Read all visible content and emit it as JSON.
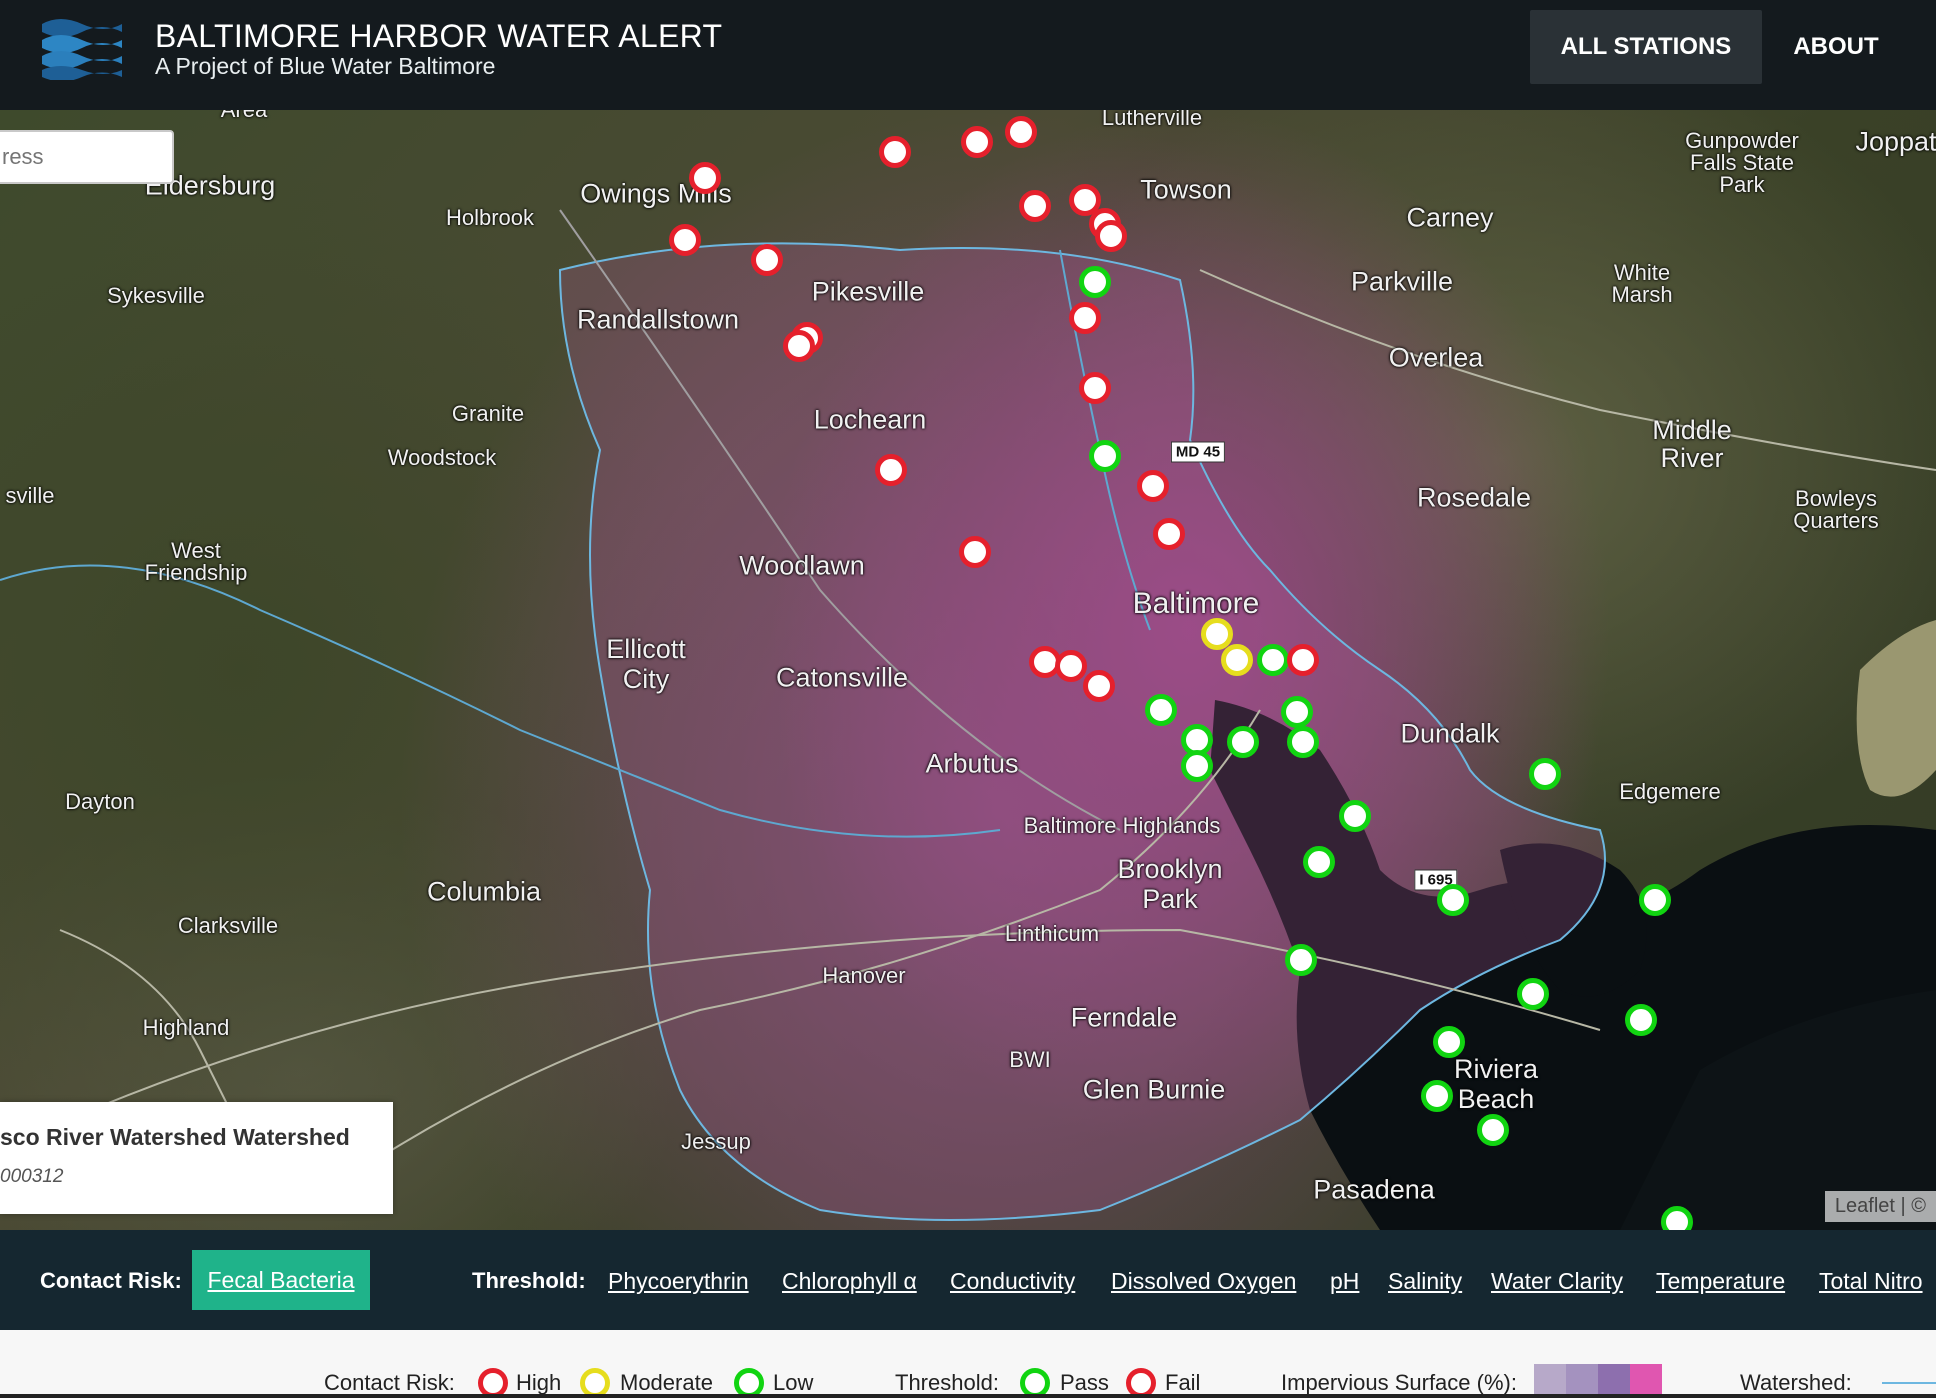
{
  "header": {
    "title": "BALTIMORE HARBOR WATER ALERT",
    "subtitle": "A Project of Blue Water Baltimore",
    "nav": {
      "all_stations": "ALL STATIONS",
      "about": "ABOUT"
    }
  },
  "search": {
    "placeholder": "ress"
  },
  "map": {
    "places": [
      "Area",
      "Eldersburg",
      "Owings Mills",
      "Holbrook",
      "Lutherville",
      "Towson",
      "Gunpowder Falls State Park",
      "Joppat",
      "Carney",
      "Sykesville",
      "Pikesville",
      "Randallstown",
      "White Marsh",
      "Parkville",
      "Overlea",
      "Granite",
      "Woodstock",
      "Lochearn",
      "Middle River",
      "sville",
      "Rosedale",
      "Bowleys Quarters",
      "West Friendship",
      "Woodlawn",
      "Baltimore",
      "Ellicott City",
      "Catonsville",
      "Dundalk",
      "Arbutus",
      "Edgemere",
      "Dayton",
      "Baltimore Highlands",
      "Brooklyn Park",
      "Columbia",
      "Linthicum",
      "Clarksville",
      "Hanover",
      "Highland",
      "Ferndale",
      "BWI",
      "Glen Burnie",
      "Riviera Beach",
      "Jessup",
      "Pasadena"
    ],
    "road_shields": [
      "MD 45",
      "I 695"
    ],
    "attribution": "Leaflet | ©"
  },
  "info_panel": {
    "title": "sco River Watershed Watershed",
    "id": "000312"
  },
  "filter_bar": {
    "contact_label": "Contact Risk:",
    "contact_active": "Fecal Bacteria",
    "threshold_label": "Threshold:",
    "threshold_items": [
      "Phycoerythrin",
      "Chlorophyll α",
      "Conductivity",
      "Dissolved Oxygen",
      "pH",
      "Salinity",
      "Water Clarity",
      "Temperature",
      "Total Nitro"
    ]
  },
  "legend": {
    "contact_label": "Contact Risk:",
    "high": "High",
    "moderate": "Moderate",
    "low": "Low",
    "threshold_label": "Threshold:",
    "pass": "Pass",
    "fail": "Fail",
    "impervious_label": "Impervious Surface (%):",
    "watershed_label": "Watershed:",
    "colors": {
      "high": "#e5202c",
      "moderate": "#e6dd1d",
      "low": "#11d411",
      "impervious": [
        "#b7a9c9",
        "#a492bf",
        "#8d6fae",
        "#e056b0"
      ]
    }
  }
}
